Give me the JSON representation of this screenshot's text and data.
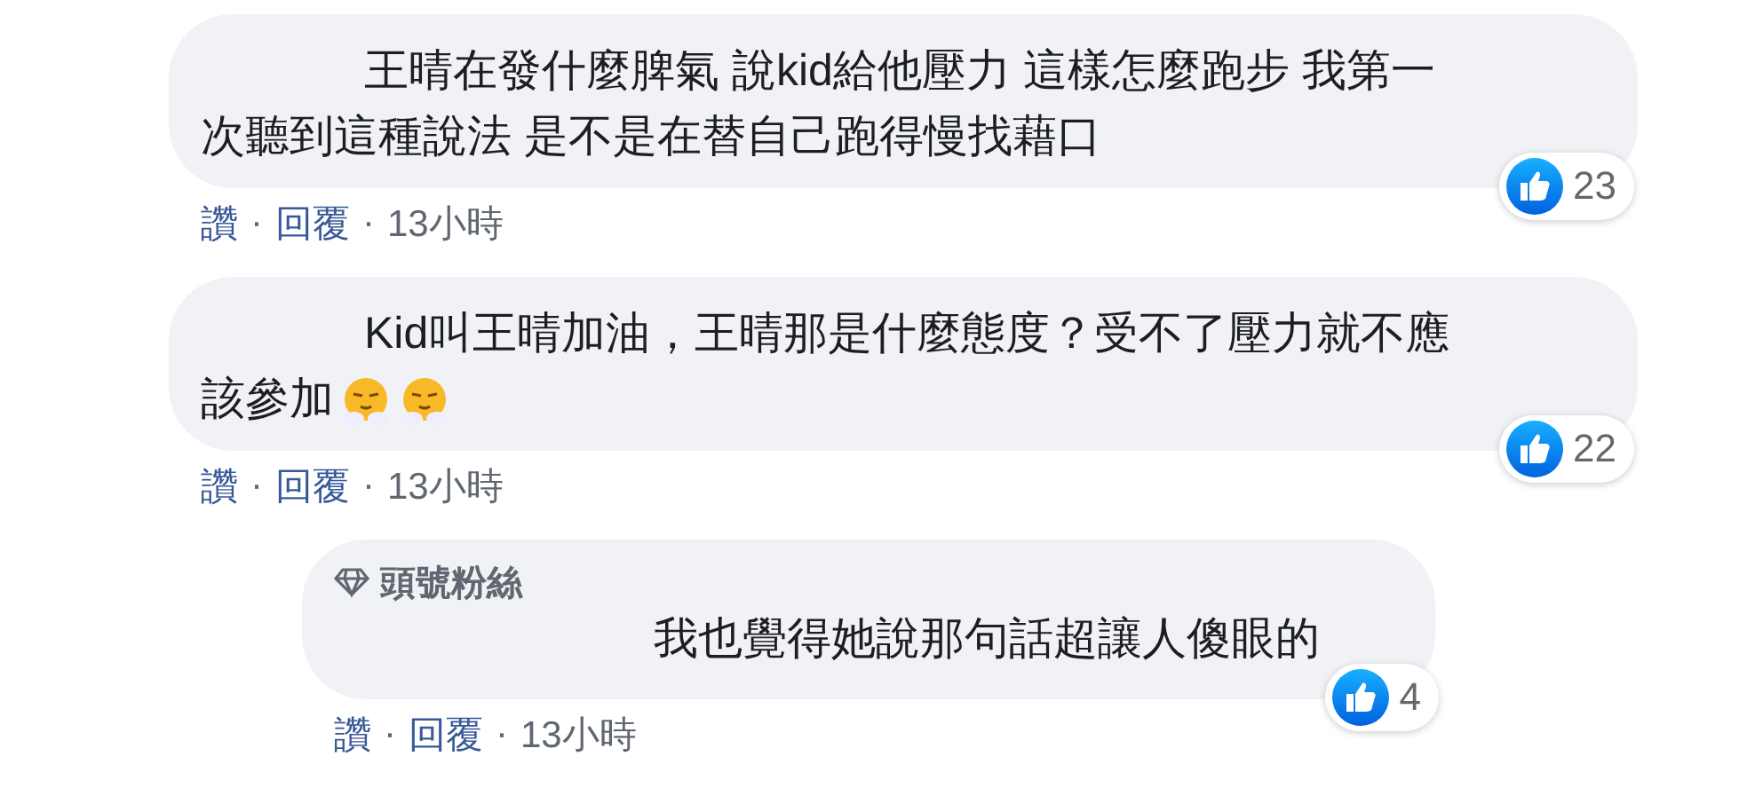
{
  "comments": [
    {
      "kind": "comment",
      "lines": [
        "王晴在發什麼脾氣 說kid給他壓力 這樣怎麼跑步 我第一",
        "次聽到這種說法 是不是在替自己跑得慢找藉口"
      ],
      "actions": {
        "like": "讚",
        "separator": "·",
        "reply": "回覆",
        "time": "13小時"
      },
      "likes": "23"
    },
    {
      "kind": "comment",
      "lines": [
        "Kid叫王晴加油，王晴那是什麼態度？受不了壓力就不應",
        "該參加"
      ],
      "emoji": [
        {
          "kind": "steam-face"
        },
        {
          "kind": "steam-face"
        }
      ],
      "actions": {
        "like": "讚",
        "separator": "·",
        "reply": "回覆",
        "time": "13小時"
      },
      "likes": "22"
    },
    {
      "kind": "reply",
      "badge": "頭號粉絲",
      "lines": [
        "我也覺得她說那句話超讓人傻眼的"
      ],
      "actions": {
        "like": "讚",
        "separator": "·",
        "reply": "回覆",
        "time": "13小時"
      },
      "likes": "4"
    }
  ]
}
